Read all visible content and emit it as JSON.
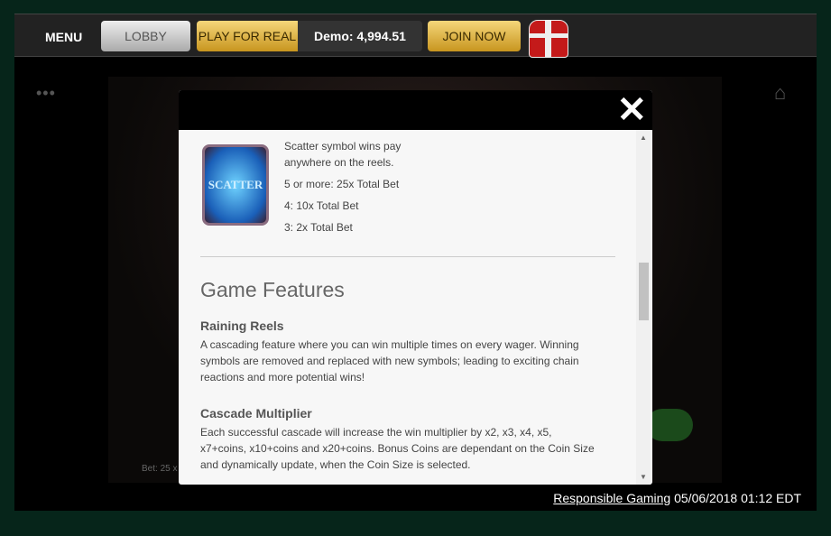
{
  "topbar": {
    "menu": "MENU",
    "lobby": "LOBBY",
    "play_for_real": "PLAY FOR REAL",
    "demo_balance": "Demo: 4,994.51",
    "join_now": "JOIN NOW"
  },
  "game": {
    "bet_text": "Bet: 25 x"
  },
  "modal": {
    "scatter_label": "SCATTER",
    "scatter_lines": [
      "Scatter symbol wins pay anywhere on the reels.",
      "5 or more: 25x Total Bet",
      "4: 10x Total Bet",
      "3: 2x Total Bet"
    ],
    "section_title": "Game Features",
    "features": [
      {
        "title": "Raining Reels",
        "text": "A cascading feature where you can win multiple times on every wager. Winning symbols are removed and replaced with new symbols; leading to exciting chain reactions and more potential wins!"
      },
      {
        "title": "Cascade Multiplier",
        "text": "Each successful cascade will increase the win multiplier by x2, x3, x4, x5, x7+coins, x10+coins and x20+coins. Bonus Coins are dependant on the Coin Size and dynamically update, when the Coin Size is selected."
      }
    ]
  },
  "footer": {
    "responsible_gaming": "Responsible Gaming",
    "datetime": "05/06/2018 01:12 EDT"
  }
}
